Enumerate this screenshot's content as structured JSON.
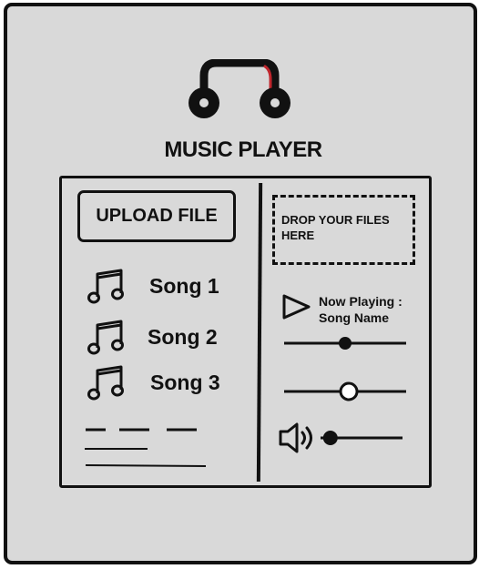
{
  "app": {
    "title": "MUSIC PLAYER"
  },
  "colors": {
    "background": "#d9d9d9",
    "ink": "#111111",
    "headphone_accent": "#c0262d"
  },
  "icons": {
    "logo": "headphones-icon",
    "song": "music-note-icon",
    "play": "play-icon",
    "volume": "volume-icon"
  },
  "upload": {
    "label": "UPLOAD FILE"
  },
  "dropzone": {
    "text_line1": "DROP YOUR FILES",
    "text_line2": "HERE"
  },
  "songs": [
    {
      "label": "Song 1"
    },
    {
      "label": "Song 2"
    },
    {
      "label": "Song 3"
    }
  ],
  "now_playing": {
    "line1": "Now Playing :",
    "line2": "Song Name"
  },
  "sliders": {
    "progress": 0.5,
    "second": 0.53,
    "volume": 0.12
  }
}
